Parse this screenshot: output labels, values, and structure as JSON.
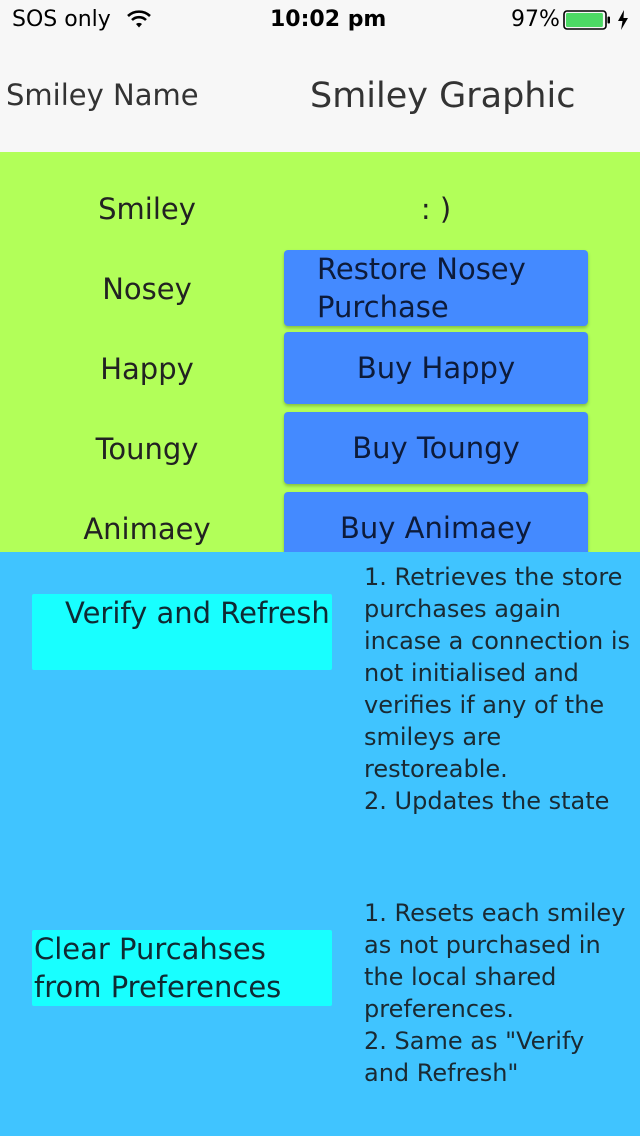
{
  "status_bar": {
    "carrier": "SOS only",
    "time": "10:02 pm",
    "battery": "97%",
    "battery_level": 0.97,
    "battery_color": "#4cd964"
  },
  "header": {
    "name_label": "Smiley Name",
    "graphic_label": "Smiley Graphic"
  },
  "smileys": [
    {
      "name": "Smiley",
      "graphic": ": )"
    },
    {
      "name": "Nosey",
      "button": "Restore Nosey Purchase"
    },
    {
      "name": "Happy",
      "button": "Buy Happy"
    },
    {
      "name": "Toungy",
      "button": "Buy Toungy"
    },
    {
      "name": "Animaey",
      "button": "Buy Animaey"
    }
  ],
  "actions": [
    {
      "label": "Verify and Refresh",
      "description": "1. Retrieves the store purchases again incase a connection is not initialised and verifies if any of the smileys are restoreable.\n2. Updates the state"
    },
    {
      "label": "Clear Purcahses from Preferences",
      "description": "1. Resets each smiley as not purchased in the local shared preferences.\n2. Same as \"Verify and Refresh\""
    }
  ],
  "colors": {
    "green_section": "#b2ff59",
    "blue_section": "#40c4ff",
    "buy_button": "#448aff",
    "action_button": "#18ffff"
  }
}
